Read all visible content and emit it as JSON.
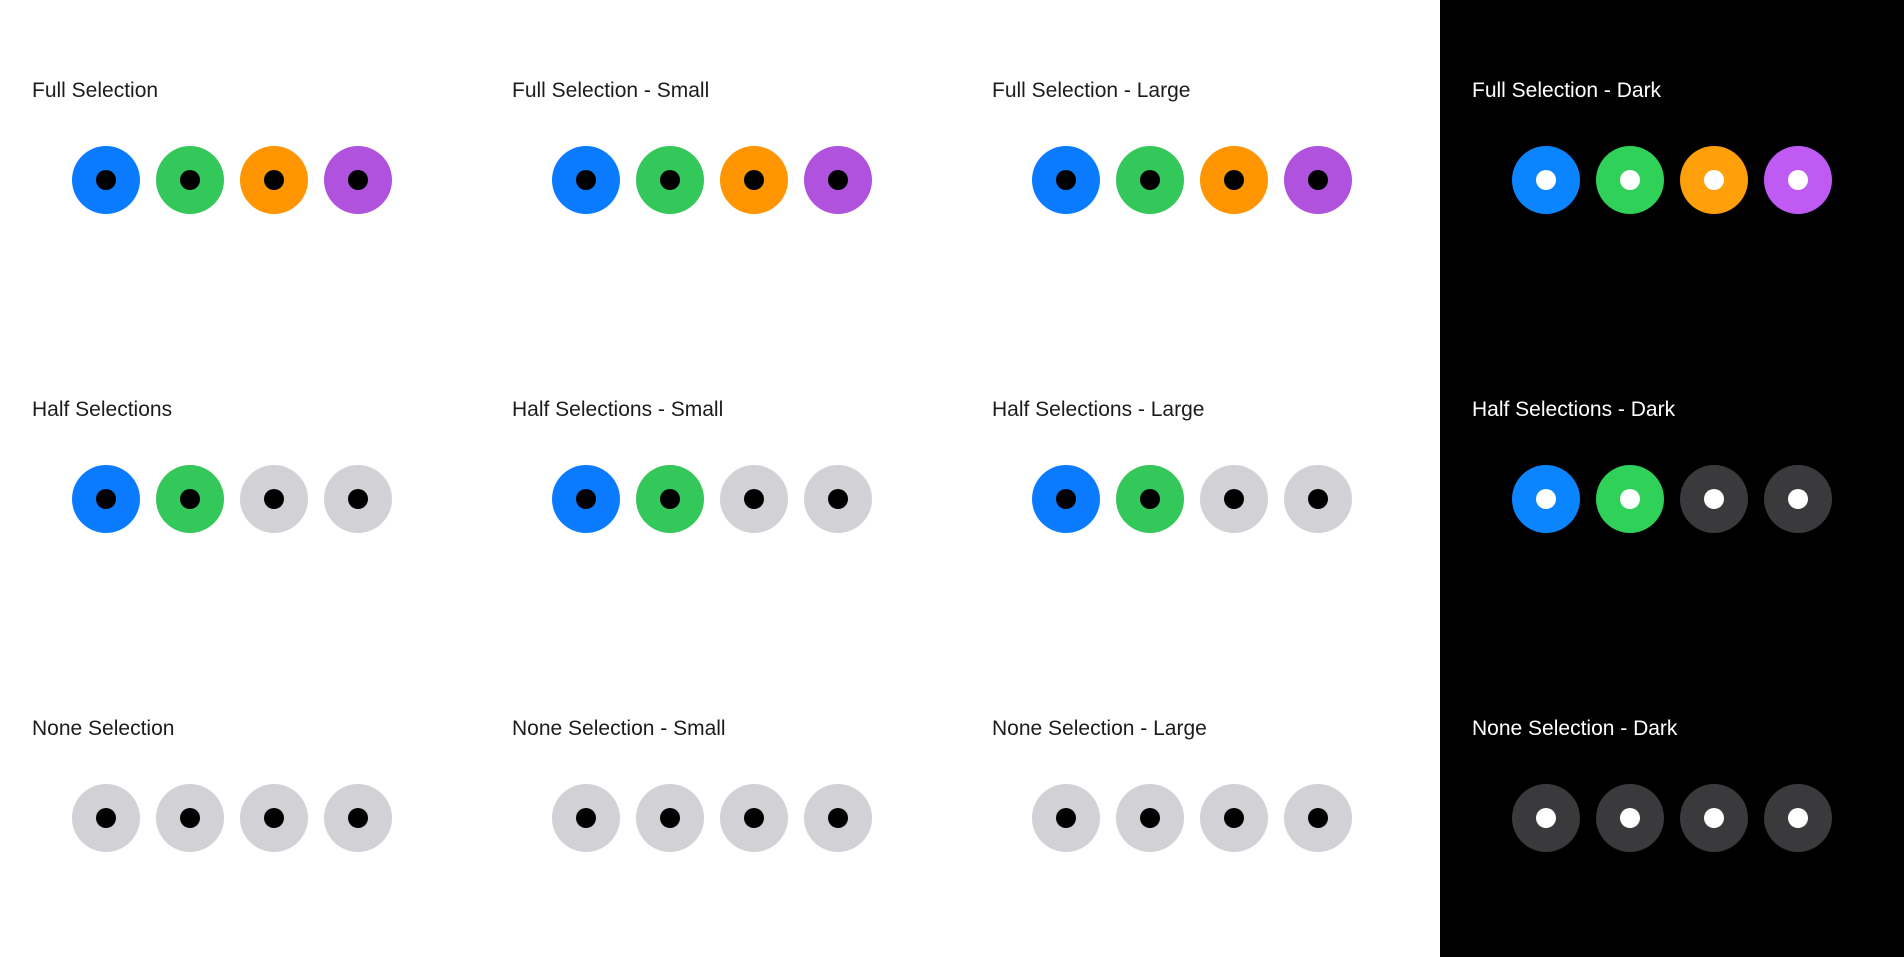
{
  "colors": {
    "light_background": "#ffffff",
    "dark_background": "#000000",
    "light_inactive": "#d1d1d6",
    "dark_inactive": "#3a3a3c",
    "light_center": "#000000",
    "dark_center": "#ffffff",
    "palette_light": [
      "#0a7aff",
      "#34c759",
      "#ff9500",
      "#af52de"
    ],
    "palette_dark": [
      "#0a84ff",
      "#30d158",
      "#ff9f0a",
      "#bf5af2"
    ]
  },
  "columns": [
    {
      "theme": "light",
      "sections": [
        {
          "title": "Full Selection",
          "active": [
            true,
            true,
            true,
            true
          ]
        },
        {
          "title": "Half Selections",
          "active": [
            true,
            true,
            false,
            false
          ]
        },
        {
          "title": "None Selection",
          "active": [
            false,
            false,
            false,
            false
          ]
        }
      ]
    },
    {
      "theme": "light",
      "sections": [
        {
          "title": "Full Selection - Small",
          "active": [
            true,
            true,
            true,
            true
          ]
        },
        {
          "title": "Half Selections - Small",
          "active": [
            true,
            true,
            false,
            false
          ]
        },
        {
          "title": "None Selection - Small",
          "active": [
            false,
            false,
            false,
            false
          ]
        }
      ]
    },
    {
      "theme": "light",
      "sections": [
        {
          "title": "Full Selection - Large",
          "active": [
            true,
            true,
            true,
            true
          ]
        },
        {
          "title": "Half Selections - Large",
          "active": [
            true,
            true,
            false,
            false
          ]
        },
        {
          "title": "None Selection - Large",
          "active": [
            false,
            false,
            false,
            false
          ]
        }
      ]
    },
    {
      "theme": "dark",
      "sections": [
        {
          "title": "Full Selection - Dark",
          "active": [
            true,
            true,
            true,
            true
          ]
        },
        {
          "title": "Half Selections - Dark",
          "active": [
            true,
            true,
            false,
            false
          ]
        },
        {
          "title": "None Selection - Dark",
          "active": [
            false,
            false,
            false,
            false
          ]
        }
      ]
    }
  ]
}
